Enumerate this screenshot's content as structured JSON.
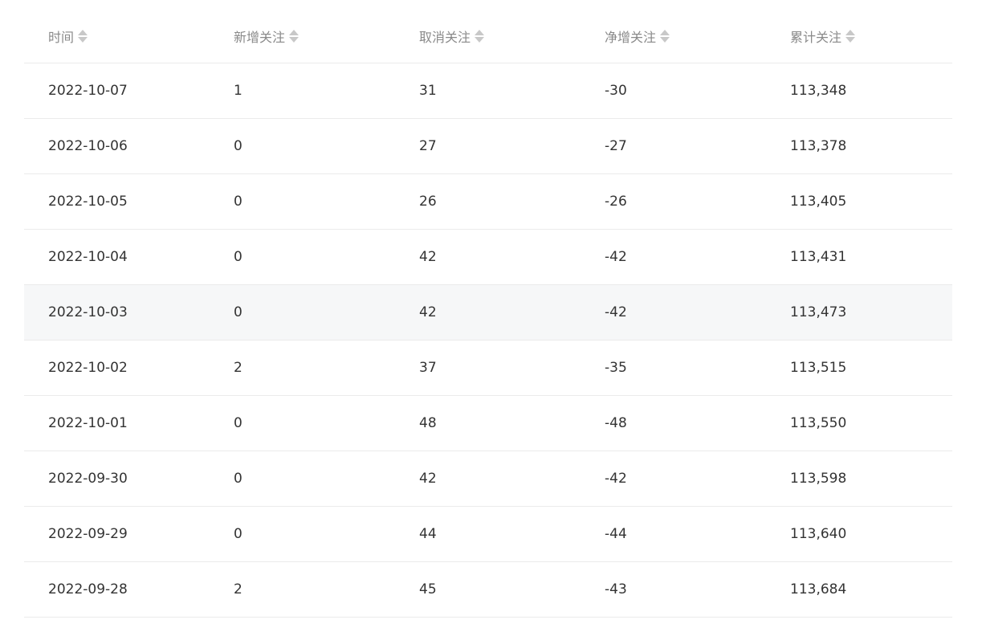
{
  "table": {
    "columns": [
      {
        "label": "时间"
      },
      {
        "label": "新增关注"
      },
      {
        "label": "取消关注"
      },
      {
        "label": "净增关注"
      },
      {
        "label": "累计关注"
      }
    ],
    "rows": [
      {
        "date": "2022-10-07",
        "new": "1",
        "cancel": "31",
        "net": "-30",
        "total": "113,348"
      },
      {
        "date": "2022-10-06",
        "new": "0",
        "cancel": "27",
        "net": "-27",
        "total": "113,378"
      },
      {
        "date": "2022-10-05",
        "new": "0",
        "cancel": "26",
        "net": "-26",
        "total": "113,405"
      },
      {
        "date": "2022-10-04",
        "new": "0",
        "cancel": "42",
        "net": "-42",
        "total": "113,431"
      },
      {
        "date": "2022-10-03",
        "new": "0",
        "cancel": "42",
        "net": "-42",
        "total": "113,473"
      },
      {
        "date": "2022-10-02",
        "new": "2",
        "cancel": "37",
        "net": "-35",
        "total": "113,515"
      },
      {
        "date": "2022-10-01",
        "new": "0",
        "cancel": "48",
        "net": "-48",
        "total": "113,550"
      },
      {
        "date": "2022-09-30",
        "new": "0",
        "cancel": "42",
        "net": "-42",
        "total": "113,598"
      },
      {
        "date": "2022-09-29",
        "new": "0",
        "cancel": "44",
        "net": "-44",
        "total": "113,640"
      },
      {
        "date": "2022-09-28",
        "new": "2",
        "cancel": "45",
        "net": "-43",
        "total": "113,684"
      }
    ],
    "highlighted_row_index": 4
  },
  "icons": {
    "sort": "sort-icon"
  },
  "colors": {
    "header_text": "#8a8a8a",
    "cell_text": "#333333",
    "divider": "#ebebeb",
    "row_highlight": "#f6f7f8",
    "sort_icon": "#c8c8c8"
  }
}
